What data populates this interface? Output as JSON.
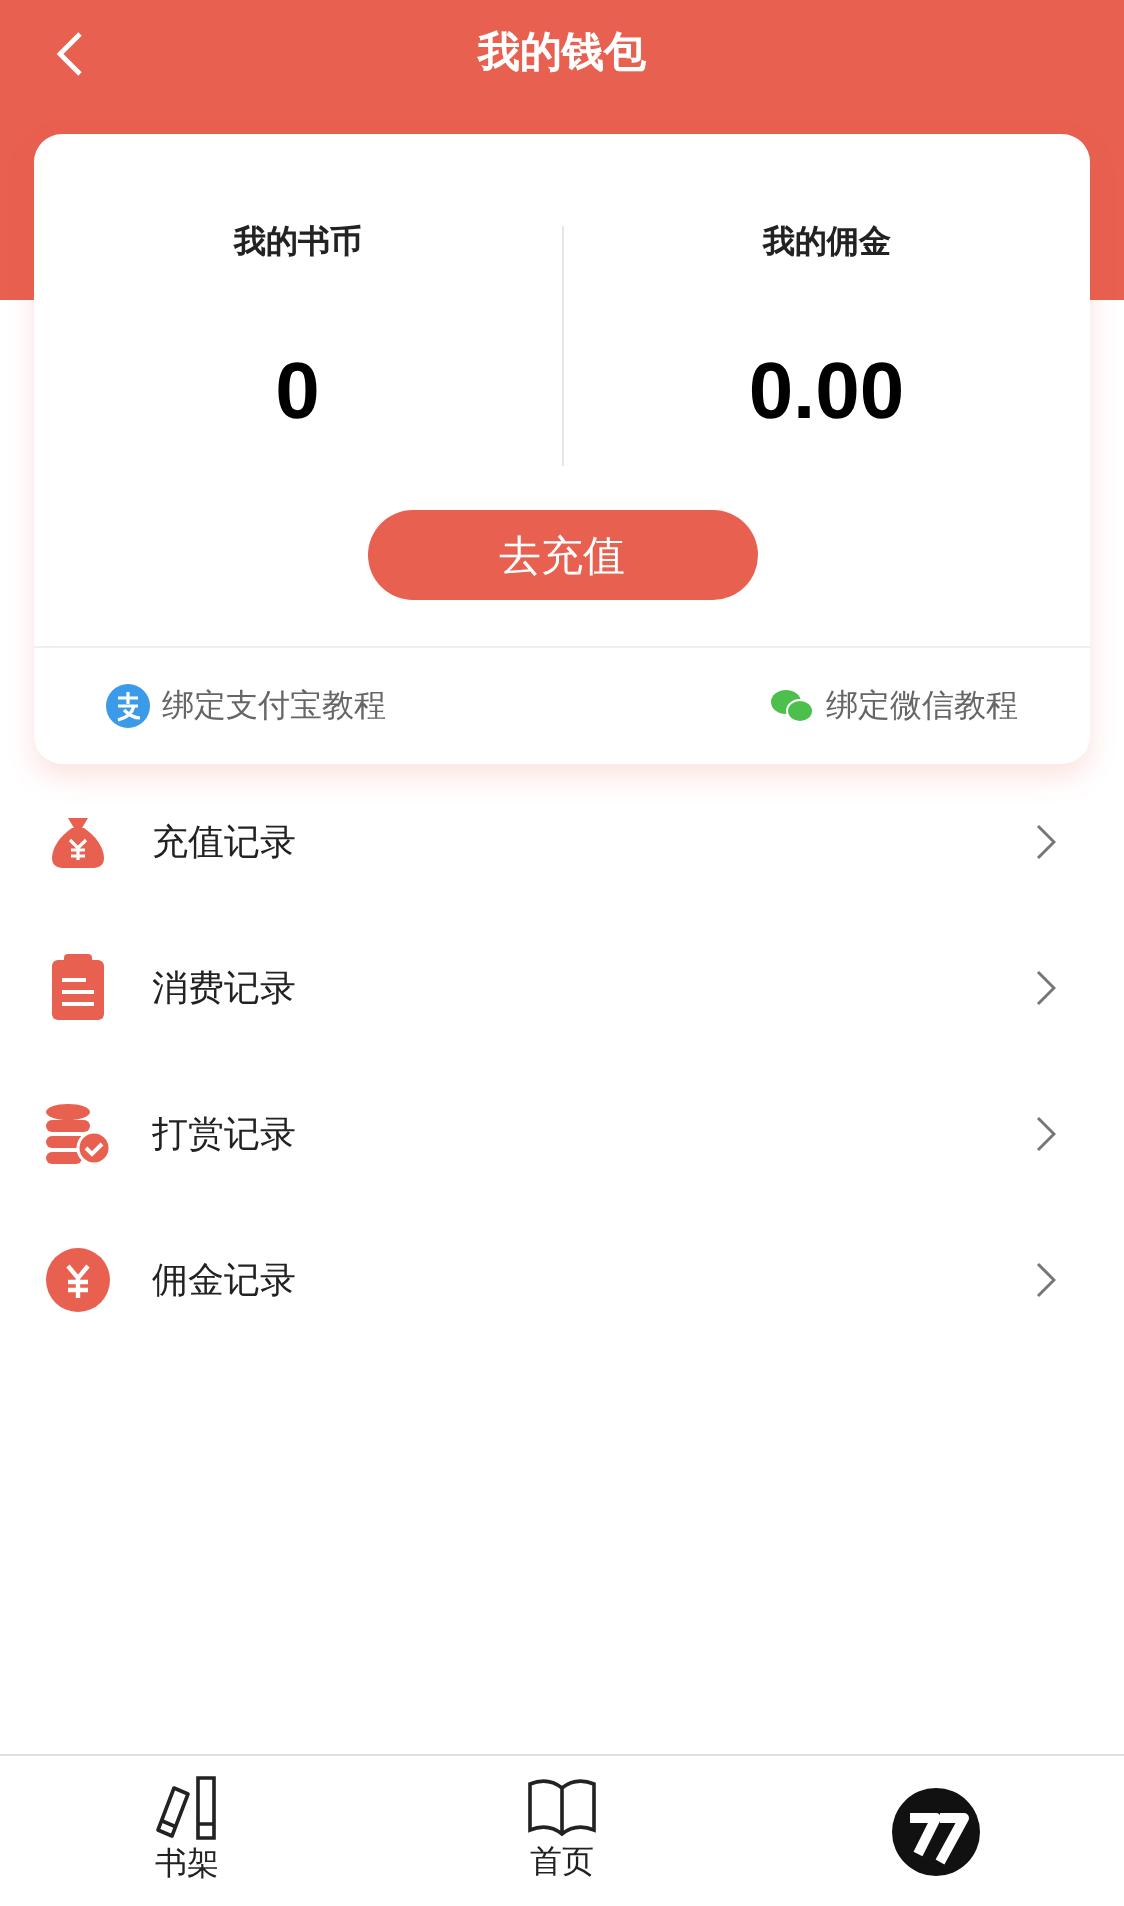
{
  "header": {
    "title": "我的钱包"
  },
  "wallet": {
    "balances": [
      {
        "label": "我的书币",
        "value": "0"
      },
      {
        "label": "我的佣金",
        "value": "0.00"
      }
    ],
    "recharge_button": "去充值",
    "tutorials": [
      {
        "kind": "alipay",
        "label": "绑定支付宝教程"
      },
      {
        "kind": "wechat",
        "label": "绑定微信教程"
      }
    ]
  },
  "records": [
    {
      "kind": "bag",
      "label": "充值记录"
    },
    {
      "kind": "clipboard",
      "label": "消费记录"
    },
    {
      "kind": "coins",
      "label": "打赏记录"
    },
    {
      "kind": "yen",
      "label": "佣金记录"
    }
  ],
  "tab_bar": [
    {
      "kind": "shelf",
      "label": "书架"
    },
    {
      "kind": "book",
      "label": "首页"
    },
    {
      "kind": "logo"
    }
  ]
}
